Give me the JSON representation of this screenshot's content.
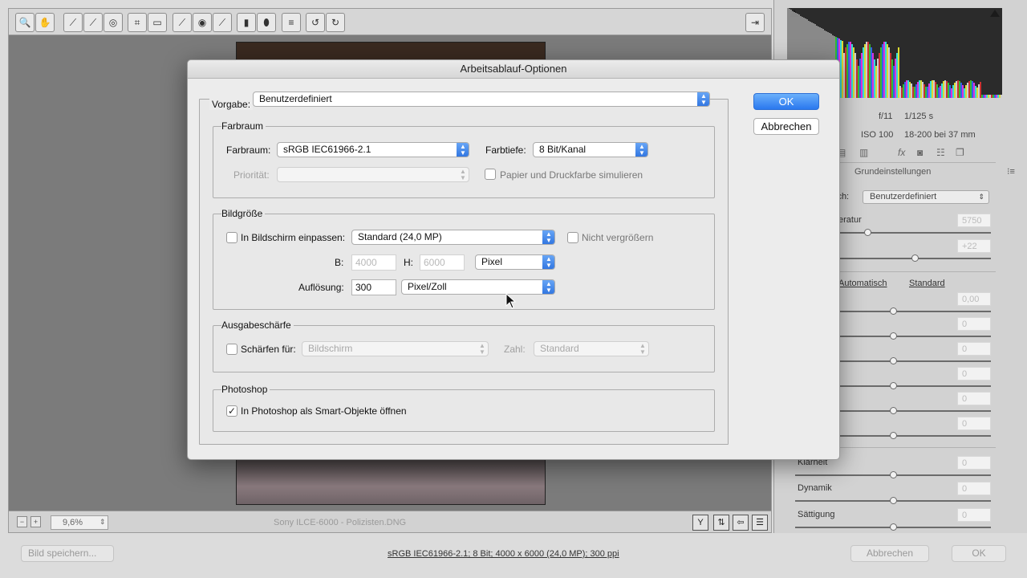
{
  "toolbar": {
    "tools": [
      {
        "icon": "zoom-icon",
        "glyph": "🔍"
      },
      {
        "icon": "hand-icon",
        "glyph": "✋"
      },
      {
        "icon": "white-balance-icon",
        "glyph": "⟋"
      },
      {
        "icon": "color-sampler-icon",
        "glyph": "⟋"
      },
      {
        "icon": "target-adjust-icon",
        "glyph": "◎"
      },
      {
        "icon": "crop-icon",
        "glyph": "⌗"
      },
      {
        "icon": "straighten-icon",
        "glyph": "▭"
      },
      {
        "icon": "spot-removal-icon",
        "glyph": "⟋"
      },
      {
        "icon": "red-eye-icon",
        "glyph": "◉"
      },
      {
        "icon": "adjustment-brush-icon",
        "glyph": "⟋"
      },
      {
        "icon": "graduated-filter-icon",
        "glyph": "▮"
      },
      {
        "icon": "radial-filter-icon",
        "glyph": "⬮"
      },
      {
        "icon": "list-icon",
        "glyph": "≡"
      },
      {
        "icon": "rotate-left-icon",
        "glyph": "↺"
      },
      {
        "icon": "rotate-right-icon",
        "glyph": "↻"
      }
    ],
    "toggle_icon": "⇥"
  },
  "status_bar": {
    "zoom": "9,6%",
    "filename": "Sony ILCE-6000 - Polizisten.DNG"
  },
  "right_panel": {
    "exif": {
      "aperture": "f/11",
      "shutter": "1/125 s",
      "iso": "ISO 100",
      "lens": "18-200 bei 37 mm"
    },
    "panel_title": "Grundeinstellungen",
    "preset_partial": "ich:",
    "preset_value": "Benutzerdefiniert",
    "temp_label": "eratur",
    "links": {
      "auto": "Automatisch",
      "standard": "Standard"
    },
    "sliders": [
      {
        "label": "",
        "value": "5750",
        "level": 0.37
      },
      {
        "label": "",
        "value": "+22",
        "level": 0.61
      },
      {
        "label": "",
        "value": "0,00",
        "level": 0.5
      },
      {
        "label": "",
        "value": "0",
        "level": 0.5
      },
      {
        "label": "",
        "value": "0",
        "level": 0.5
      },
      {
        "label": "",
        "value": "0",
        "level": 0.5
      },
      {
        "label": "",
        "value": "0",
        "level": 0.5
      },
      {
        "label": "",
        "value": "0",
        "level": 0.5
      },
      {
        "label": "Klarheit",
        "value": "0",
        "level": 0.5
      },
      {
        "label": "Dynamik",
        "value": "0",
        "level": 0.5
      },
      {
        "label": "Sättigung",
        "value": "0",
        "level": 0.5
      }
    ]
  },
  "footer": {
    "save_label": "Bild speichern...",
    "info_link": "sRGB IEC61966-2.1; 8 Bit; 4000 x 6000 (24,0 MP); 300 ppi",
    "cancel_label": "Abbrechen",
    "ok_label": "OK"
  },
  "dialog": {
    "title": "Arbeitsablauf-Optionen",
    "preset_label": "Vorgabe:",
    "preset_value": "Benutzerdefiniert",
    "ok_label": "OK",
    "cancel_label": "Abbrechen",
    "color_space": {
      "title": "Farbraum",
      "space_label": "Farbraum:",
      "space_value": "sRGB IEC61966-2.1",
      "depth_label": "Farbtiefe:",
      "depth_value": "8 Bit/Kanal",
      "priority_label": "Priorität:",
      "priority_value": "",
      "simulate_label": "Papier und Druckfarbe simulieren",
      "simulate_checked": false
    },
    "image_size": {
      "title": "Bildgröße",
      "fit_label": "In Bildschirm einpassen:",
      "fit_checked": false,
      "size_value": "Standard  (24,0 MP)",
      "no_enlarge_label": "Nicht vergrößern",
      "no_enlarge_checked": false,
      "w_label": "B:",
      "w_value": "4000",
      "h_label": "H:",
      "h_value": "6000",
      "unit_value": "Pixel",
      "resolution_label": "Auflösung:",
      "resolution_value": "300",
      "resolution_unit": "Pixel/Zoll"
    },
    "sharpening": {
      "title": "Ausgabeschärfe",
      "sharpen_label": "Schärfen für:",
      "sharpen_checked": false,
      "sharpen_value": "Bildschirm",
      "amount_label": "Zahl:",
      "amount_value": "Standard"
    },
    "photoshop": {
      "title": "Photoshop",
      "smart_label": "In Photoshop als Smart-Objekte öffnen",
      "smart_checked": true
    }
  },
  "colors": {
    "accent": "#2f74e0",
    "background_panel": "#d2d2d2"
  }
}
